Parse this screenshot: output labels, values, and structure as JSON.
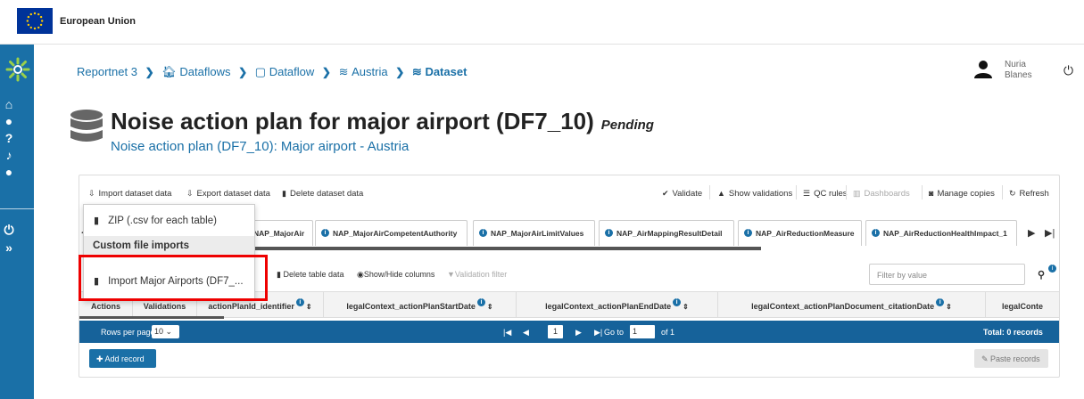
{
  "eu_bar": {
    "title": "European Union"
  },
  "breadcrumb": {
    "items": [
      {
        "label": "Reportnet 3",
        "icon": ""
      },
      {
        "label": "Dataflows",
        "icon": "home-icon"
      },
      {
        "label": "Dataflow",
        "icon": "clone-icon"
      },
      {
        "label": "Austria",
        "icon": "database-icon"
      },
      {
        "label": "Dataset",
        "icon": "database-icon"
      }
    ]
  },
  "user": {
    "first": "Nuria",
    "last": "Blanes"
  },
  "header": {
    "title": "Noise action plan for major airport (DF7_10)",
    "status": "Pending",
    "subtitle": "Noise action plan (DF7_10): Major airport - Austria"
  },
  "toolbar": {
    "import": "Import dataset data",
    "export": "Export dataset data",
    "delete": "Delete dataset data",
    "validate": "Validate",
    "show_validations": "Show validations",
    "qc_rules": "QC rules",
    "dashboards": "Dashboards",
    "manage_copies": "Manage copies",
    "refresh": "Refresh"
  },
  "tabs": [
    {
      "label": "NAP_MajorAir"
    },
    {
      "label": "NAP_MajorAirCompetentAuthority"
    },
    {
      "label": "NAP_MajorAirLimitValues"
    },
    {
      "label": "NAP_AirMappingResultDetail"
    },
    {
      "label": "NAP_AirReductionMeasure"
    },
    {
      "label": "NAP_AirReductionHealthImpact_1"
    }
  ],
  "table_toolbar": {
    "delete_table": "Delete table data",
    "show_hide": "Show/Hide columns",
    "validation_filter": "Validation filter",
    "filter_placeholder": "Filter by value"
  },
  "columns": [
    "Actions",
    "Validations",
    "actionPlanId_identifier",
    "legalContext_actionPlanStartDate",
    "legalContext_actionPlanEndDate",
    "legalContext_actionPlanDocument_citationDate",
    "legalConte"
  ],
  "pager": {
    "rows_label": "Rows per page",
    "rows_value": "10",
    "page": "1",
    "goto_label": "Go to",
    "goto_value": "1",
    "of_label": "of 1",
    "total": "Total: 0 records"
  },
  "actions": {
    "add_record": "Add record",
    "paste_records": "Paste records"
  },
  "dropdown": {
    "zip": "ZIP (.csv for each table)",
    "custom_header": "Custom file imports",
    "import_major": "Import Major Airports (DF7_..."
  },
  "colors": {
    "primary": "#1a70a7",
    "pager": "#16629a",
    "highlight": "#ee0000"
  }
}
